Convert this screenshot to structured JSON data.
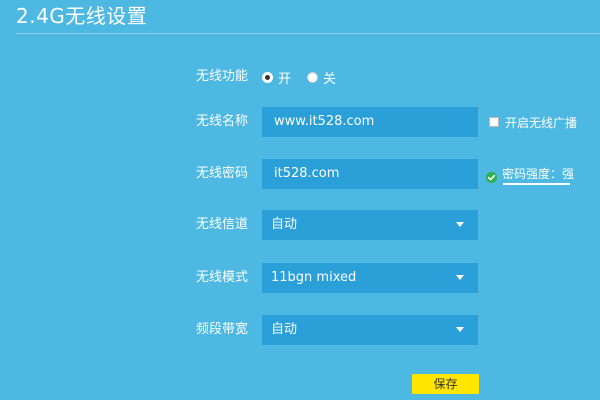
{
  "page": {
    "title": "2.4G无线设置"
  },
  "wireless_function": {
    "label": "无线功能",
    "options": [
      "开",
      "关"
    ],
    "selected": "开"
  },
  "wireless_name": {
    "label": "无线名称",
    "value": "www.it528.com",
    "broadcast_label": "开启无线广播",
    "broadcast_checked": false
  },
  "wireless_password": {
    "label": "无线密码",
    "value": "it528.com",
    "strength_text": "密码强度：强"
  },
  "wireless_channel": {
    "label": "无线信道",
    "value": "自动"
  },
  "wireless_mode": {
    "label": "无线模式",
    "value": "11bgn mixed"
  },
  "bandwidth": {
    "label": "频段带宽",
    "value": "自动"
  },
  "save_label": "保存",
  "colors": {
    "background": "#4db8e2",
    "field": "#2a9fd8",
    "save_button": "#ffe600",
    "strength_ok": "#2bb24c"
  },
  "icons": {
    "radio_on": "radio-checked-icon",
    "radio_off": "radio-unchecked-icon",
    "caret": "caret-down-icon",
    "check": "check-circle-icon"
  }
}
